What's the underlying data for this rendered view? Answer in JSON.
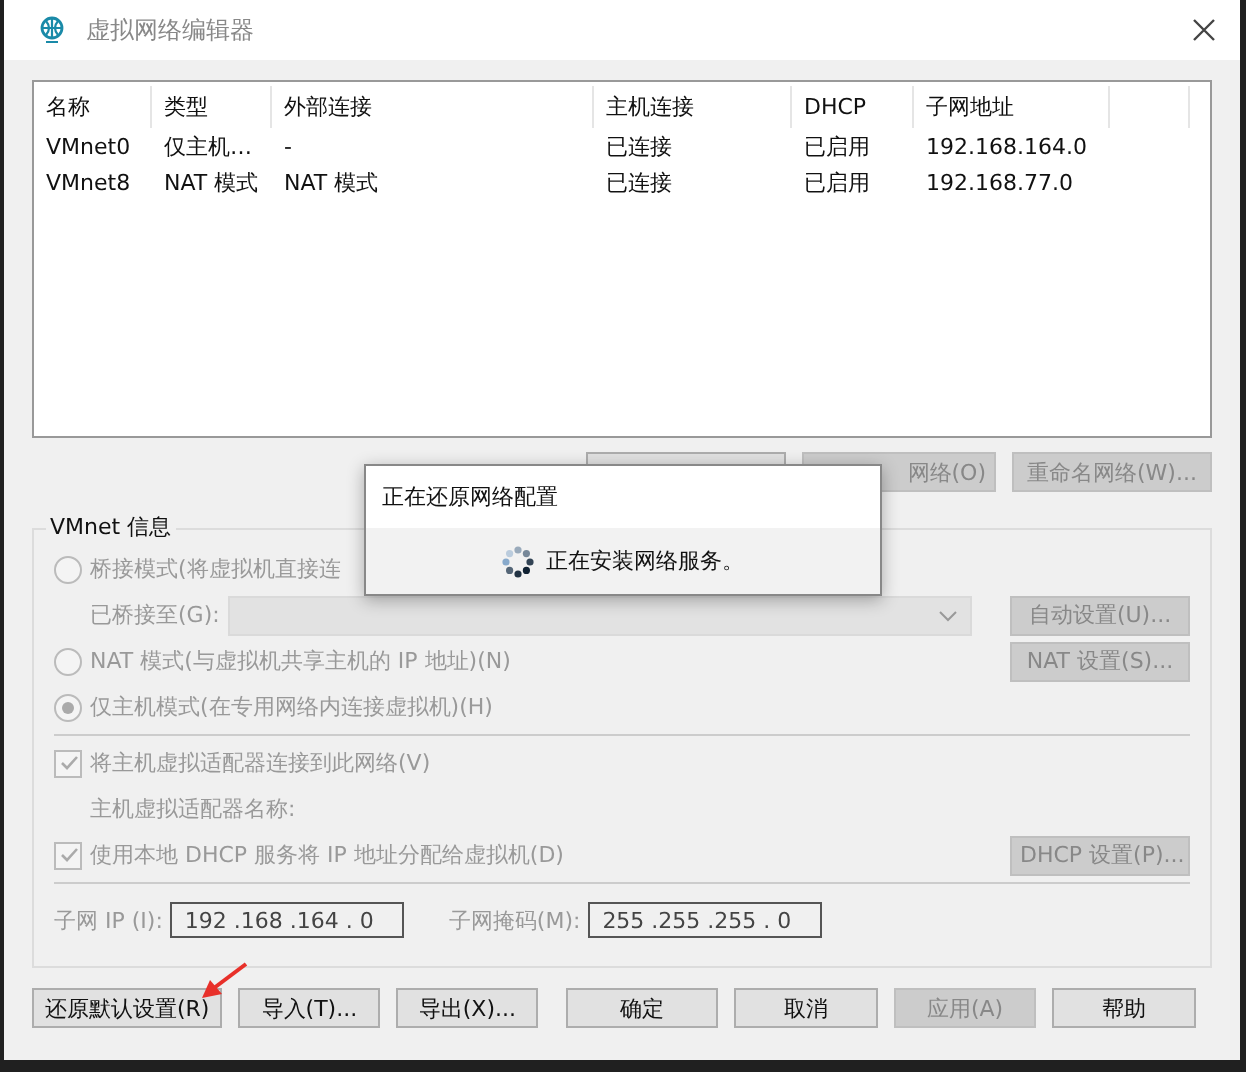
{
  "window": {
    "title": "虚拟网络编辑器"
  },
  "network_list": {
    "columns": [
      "名称",
      "类型",
      "外部连接",
      "主机连接",
      "DHCP",
      "子网地址"
    ],
    "rows": [
      {
        "cells": [
          "VMnet0",
          "仅主机…",
          "-",
          "已连接",
          "已启用",
          "192.168.164.0"
        ]
      },
      {
        "cells": [
          "VMnet8",
          "NAT 模式",
          "NAT 模式",
          "已连接",
          "已启用",
          "192.168.77.0"
        ]
      }
    ]
  },
  "list_buttons": [
    {
      "disabled": false
    },
    {
      "label": "网络(O)",
      "disabled": true
    },
    {
      "label": "重命名网络(W)...",
      "disabled": true
    }
  ],
  "vmnet_info": {
    "title": "VMnet 信息",
    "bridge_mode": {
      "label": "桥接模式(将虚拟机直接连",
      "selected": false,
      "disabled": true
    },
    "bridged_to": {
      "label": "已桥接至(G):",
      "disabled": true
    },
    "auto_settings_button": {
      "label": "自动设置(U)...",
      "disabled": true
    },
    "nat_mode": {
      "label": "NAT 模式(与虚拟机共享主机的 IP 地址)(N)",
      "selected": false,
      "disabled": true
    },
    "nat_settings_button": {
      "label": "NAT 设置(S)...",
      "disabled": true
    },
    "host_only_mode": {
      "label": "仅主机模式(在专用网络内连接虚拟机)(H)",
      "selected": true,
      "disabled": true
    },
    "connect_adapter": {
      "label": "将主机虚拟适配器连接到此网络(V)",
      "checked": true,
      "disabled": true
    },
    "adapter_name_label": "主机虚拟适配器名称:",
    "use_dhcp": {
      "label": "使用本地 DHCP 服务将 IP 地址分配给虚拟机(D)",
      "checked": true,
      "disabled": true
    },
    "dhcp_settings_button": {
      "label": "DHCP 设置(P)...",
      "disabled": true
    },
    "subnet_ip": {
      "label": "子网 IP (I):",
      "value": "192 .168 .164 . 0"
    },
    "subnet_mask": {
      "label": "子网掩码(M):",
      "value": "255 .255 .255 . 0"
    }
  },
  "bottom_buttons": [
    {
      "label": "还原默认设置(R)",
      "disabled": false
    },
    {
      "label": "导入(T)...",
      "disabled": false
    },
    {
      "label": "导出(X)...",
      "disabled": false
    },
    {
      "label": "确定",
      "disabled": false
    },
    {
      "label": "取消",
      "disabled": false
    },
    {
      "label": "应用(A)",
      "disabled": true
    },
    {
      "label": "帮助",
      "disabled": false
    }
  ],
  "progress_dialog": {
    "title": "正在还原网络配置",
    "message": "正在安装网络服务。"
  }
}
